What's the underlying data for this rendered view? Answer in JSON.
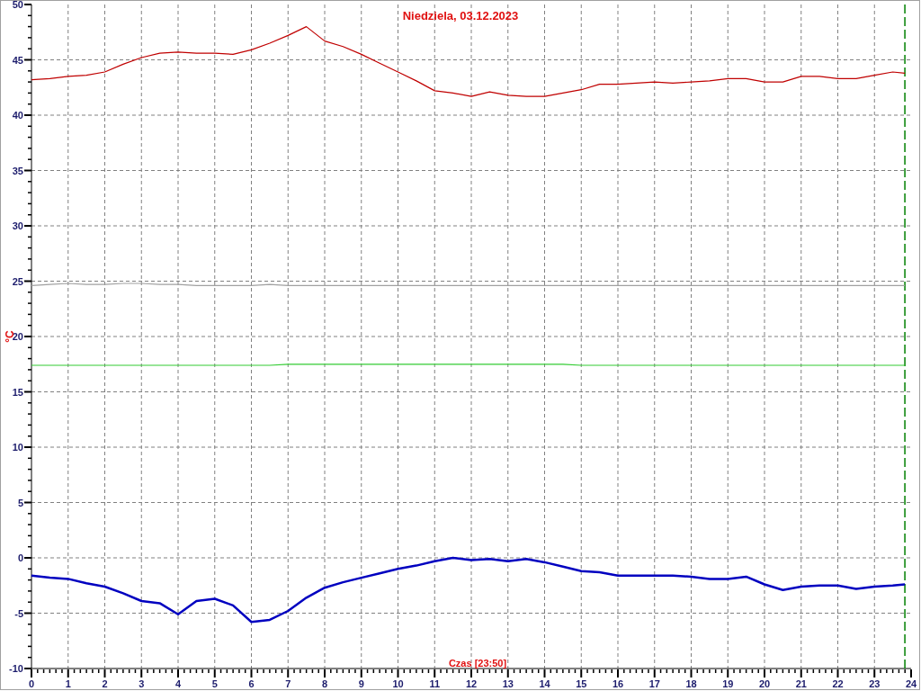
{
  "chart_data": {
    "type": "line",
    "title": "Niedziela, 03.12.2023",
    "xlabel": "Czas [23:50]",
    "ylabel": "°C",
    "x": [
      0,
      0.5,
      1,
      1.5,
      2,
      2.5,
      3,
      3.5,
      4,
      4.5,
      5,
      5.5,
      6,
      6.5,
      7,
      7.5,
      8,
      8.5,
      9,
      9.5,
      10,
      10.5,
      11,
      11.5,
      12,
      12.5,
      13,
      13.5,
      14,
      14.5,
      15,
      15.5,
      16,
      16.5,
      17,
      17.5,
      18,
      18.5,
      19,
      19.5,
      20,
      20.5,
      21,
      21.5,
      22,
      22.5,
      23,
      23.5,
      23.83
    ],
    "series": [
      {
        "color": "#c00000",
        "values": [
          43.2,
          43.3,
          43.5,
          43.6,
          43.9,
          44.6,
          45.2,
          45.6,
          45.7,
          45.6,
          45.6,
          45.5,
          45.9,
          46.5,
          47.2,
          48.0,
          46.7,
          46.2,
          45.5,
          44.7,
          43.9,
          43.1,
          42.2,
          42.0,
          41.7,
          42.1,
          41.8,
          41.7,
          41.7,
          42.0,
          42.3,
          42.8,
          42.8,
          42.9,
          43.0,
          42.9,
          43.0,
          43.1,
          43.3,
          43.3,
          43.0,
          43.0,
          43.5,
          43.5,
          43.3,
          43.3,
          43.6,
          43.9,
          43.8
        ]
      },
      {
        "color": "#a0a0a0",
        "values": [
          24.6,
          24.7,
          24.8,
          24.7,
          24.7,
          24.8,
          24.8,
          24.7,
          24.7,
          24.6,
          24.6,
          24.6,
          24.6,
          24.7,
          24.6,
          24.6,
          24.6,
          24.6,
          24.6,
          24.6,
          24.6,
          24.6,
          24.6,
          24.6,
          24.6,
          24.6,
          24.6,
          24.6,
          24.6,
          24.6,
          24.6,
          24.6,
          24.6,
          24.6,
          24.6,
          24.6,
          24.6,
          24.6,
          24.6,
          24.6,
          24.6,
          24.6,
          24.6,
          24.6,
          24.6,
          24.6,
          24.6,
          24.6,
          24.6
        ]
      },
      {
        "color": "#33cc33",
        "values": [
          17.4,
          17.4,
          17.4,
          17.4,
          17.4,
          17.4,
          17.4,
          17.4,
          17.4,
          17.4,
          17.4,
          17.4,
          17.4,
          17.4,
          17.5,
          17.5,
          17.5,
          17.5,
          17.5,
          17.5,
          17.5,
          17.5,
          17.5,
          17.5,
          17.5,
          17.5,
          17.5,
          17.5,
          17.5,
          17.5,
          17.4,
          17.4,
          17.4,
          17.4,
          17.4,
          17.4,
          17.4,
          17.4,
          17.4,
          17.4,
          17.4,
          17.4,
          17.4,
          17.4,
          17.4,
          17.4,
          17.4,
          17.4,
          17.4
        ]
      },
      {
        "color": "#0000c0",
        "values": [
          -1.6,
          -1.8,
          -1.9,
          -2.3,
          -2.6,
          -3.2,
          -3.9,
          -4.1,
          -5.1,
          -3.9,
          -3.7,
          -4.3,
          -5.8,
          -5.6,
          -4.8,
          -3.6,
          -2.7,
          -2.2,
          -1.8,
          -1.4,
          -1.0,
          -0.7,
          -0.3,
          0.0,
          -0.2,
          -0.1,
          -0.3,
          -0.1,
          -0.4,
          -0.8,
          -1.2,
          -1.3,
          -1.6,
          -1.6,
          -1.6,
          -1.6,
          -1.7,
          -1.9,
          -1.9,
          -1.7,
          -2.4,
          -2.9,
          -2.6,
          -2.5,
          -2.5,
          -2.8,
          -2.6,
          -2.5,
          -2.4
        ]
      }
    ],
    "xlim": [
      0,
      24
    ],
    "ylim": [
      -10,
      50
    ],
    "xticks": [
      0,
      1,
      2,
      3,
      4,
      5,
      6,
      7,
      8,
      9,
      10,
      11,
      12,
      13,
      14,
      15,
      16,
      17,
      18,
      19,
      20,
      21,
      22,
      23,
      24
    ],
    "yticks": [
      -10,
      -5,
      0,
      5,
      10,
      15,
      20,
      25,
      30,
      35,
      40,
      45,
      50
    ],
    "grid": true,
    "ref_lines": [
      {
        "axis": "x",
        "value": 23.83,
        "color": "#008000"
      }
    ]
  }
}
